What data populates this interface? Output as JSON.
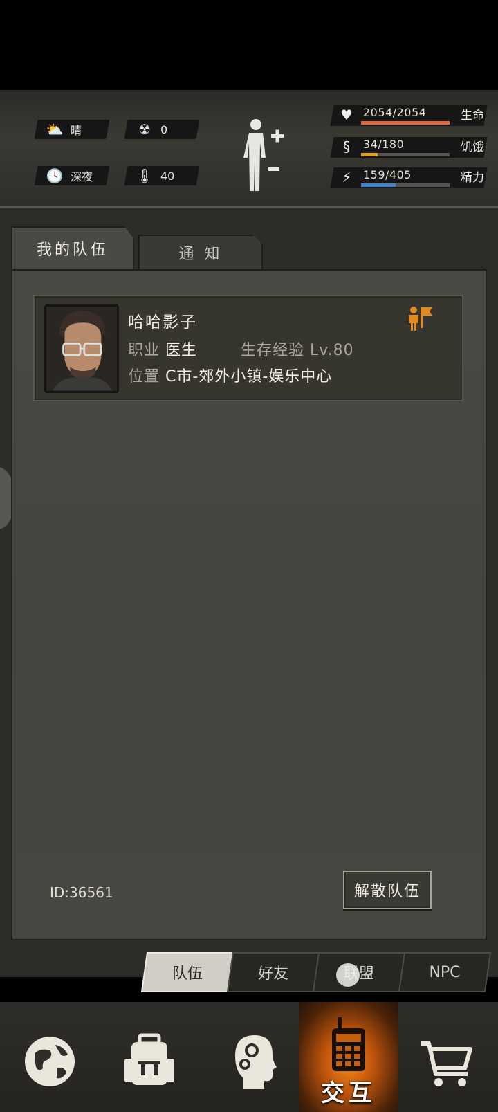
{
  "status": {
    "weather": {
      "icon": "partly-cloudy-icon",
      "label": "晴"
    },
    "radiation": {
      "icon": "radiation-icon",
      "value": "0"
    },
    "time_of_day": {
      "icon": "clock-icon",
      "label": "深夜"
    },
    "temperature": {
      "icon": "thermometer-icon",
      "value": "40"
    },
    "health": {
      "icon": "heart-pulse-icon",
      "value": "2054/2054",
      "label": "生命",
      "fraction": 1.0,
      "color": "#e2683e"
    },
    "hunger": {
      "icon": "stomach-icon",
      "value": "34/180",
      "label": "饥饿",
      "fraction": 0.19,
      "color": "#e0a127"
    },
    "energy": {
      "icon": "energy-head-icon",
      "value": "159/405",
      "label": "精力",
      "fraction": 0.39,
      "color": "#3f82c8"
    }
  },
  "tabs": {
    "my_team": "我的队伍",
    "notice": "通 知"
  },
  "member": {
    "name": "哈哈影子",
    "profession_label": "职业",
    "profession": "医生",
    "exp_label": "生存经验",
    "level": "Lv.80",
    "location_label": "位置",
    "location": "C市-郊外小镇-娱乐中心"
  },
  "footer": {
    "id_text": "ID:36561",
    "disband_label": "解散队伍"
  },
  "subtabs": [
    "队伍",
    "好友",
    "联盟",
    "NPC"
  ],
  "bottom_nav": {
    "items": [
      "world-map-icon",
      "backpack-icon",
      "skills-head-icon",
      "walkie-talkie-icon",
      "shopping-cart-icon"
    ],
    "active_label": "交互"
  }
}
